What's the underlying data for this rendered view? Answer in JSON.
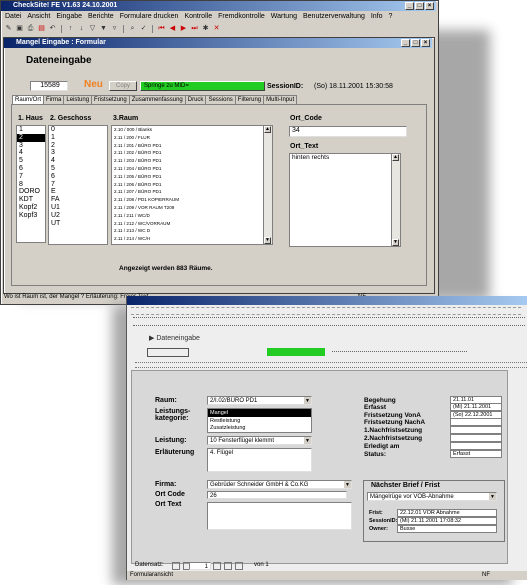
{
  "app": {
    "title": "CheckSite! FE V1.63 24.10.2001",
    "menu": [
      "Datei",
      "Ansicht",
      "Eingabe",
      "Berichte",
      "Formulare drucken",
      "Kontrolle",
      "Fremdkontrolle",
      "Wartung",
      "Benutzerverwaltung",
      "Info",
      "?"
    ],
    "toolbar_icons": [
      "edit-icon",
      "save-icon",
      "print-icon",
      "preview-icon",
      "undo-icon",
      "sort-asc-icon",
      "sort-desc-icon",
      "filter-icon",
      "filter-apply-icon",
      "filter-remove-icon",
      "find-icon",
      "spell-icon",
      "first-icon",
      "prev-icon",
      "next-icon",
      "last-icon",
      "new-record-icon",
      "delete-record-icon"
    ],
    "status_text": "Wo ist Raum ist, der Mangel ? Erläuterung: Freier Text",
    "status_right": "NF"
  },
  "form1": {
    "title": "Mangel Eingabe : Formular",
    "heading": "Dateneingabe",
    "record_id": "15589",
    "neu_label": "Neu",
    "copy_label": "Copy",
    "jump_label": "Springe zu MID=",
    "session_label": "SessionID:",
    "session_value": "(So) 18.11.2001 15:30:58",
    "tabs": [
      "Raum/Ort",
      "Firma",
      "Leistung",
      "Fristsetzung",
      "Zusammenfassung",
      "Druck",
      "Sessions",
      "Filterung",
      "Multi-Input"
    ],
    "col1_header": "1. Haus",
    "col2_header": "2. Geschoss",
    "col3_header": "3.Raum",
    "haus": [
      "1",
      "2",
      "3",
      "4",
      "5",
      "6",
      "7",
      "8",
      "DORO",
      "KDT",
      "Kopf2",
      "Kopf3"
    ],
    "geschoss": [
      "0",
      "1",
      "2",
      "3",
      "4",
      "5",
      "6",
      "7",
      "E",
      "FA",
      "U1",
      "U2",
      "UT"
    ],
    "raum": [
      "2.10 / 000 / Blanks",
      "2.11 / 200 / FLUR",
      "2.11 / 201 / BÜRO PD1",
      "2.11 / 202 / BÜRO PD1",
      "2.11 / 203 / BÜRO PD1",
      "2.11 / 204 / BÜRO PD1",
      "2.11 / 205 / BÜRO PD1",
      "2.11 / 206 / BÜRO PD1",
      "2.11 / 207 / BÜRO PD1",
      "2.11 / 208 / PD1 KOPIERRAUM",
      "2.11 / 209 / VOR RAUM T209",
      "2.11 / 211 / WC/D",
      "2.11 / 212 / WC/VORRAUM",
      "2.11 / 213 / WC D",
      "2.11 / 214 / WC/H",
      "2.11 / 220 / KOPIERR."
    ],
    "ort_code_label": "Ort_Code",
    "ort_code_value": "34",
    "ort_text_label": "Ort_Text",
    "ort_text_value": "hinten rechts",
    "footer_text": "Angezeigt werden 883 Räume."
  },
  "form2": {
    "title": "Formularansicht",
    "heading": "Dateneingabe",
    "raum_label": "Raum:",
    "raum_value": "2/I.02/BÜRO PD1",
    "leistung_label": "Leistungs-kategorie:",
    "leistung_items": [
      "Mangel",
      "Restleistung",
      "Zusatzleistung"
    ],
    "leistung2_label": "Leistung:",
    "leistung2_value": "10 Fensterflügel klemmt",
    "erl_label": "Erläuterung",
    "erl_value": "4. Flügel",
    "firma_label": "Firma:",
    "firma_value": "Gebrüder Schneider GmbH & Co.KG",
    "ortcode_label": "Ort Code",
    "ortcode_value": "26",
    "orttext_label": "Ort Text",
    "right_labels": [
      "Begehung",
      "Erfasst",
      "Fristsetzung VonA",
      "Fristsetzung NachA",
      "1.Nachfristsetzung",
      "2.Nachfristsetzung",
      "Erledigt am",
      "Status:"
    ],
    "right_values": [
      "21.11.01",
      "(Mi) 21.11.2001",
      "(So) 22.12.2001",
      "",
      "",
      "",
      "",
      "Erfasst"
    ],
    "brief_title": "Nächster Brief / Frist",
    "brief_value": "Mängelrüge vor VOB-Abnahme",
    "info_labels": [
      "Frist:",
      "SessionID:",
      "Owner:"
    ],
    "info_values": [
      "22.12.01 VOR Abnahme",
      "(Mi) 21.11.2001 17:08:32",
      "Busse"
    ],
    "nav_label": "Datensatz:",
    "nav_record": "1",
    "nav_of": "von 1",
    "status_left": "Formularansicht",
    "status_right": "NF"
  }
}
